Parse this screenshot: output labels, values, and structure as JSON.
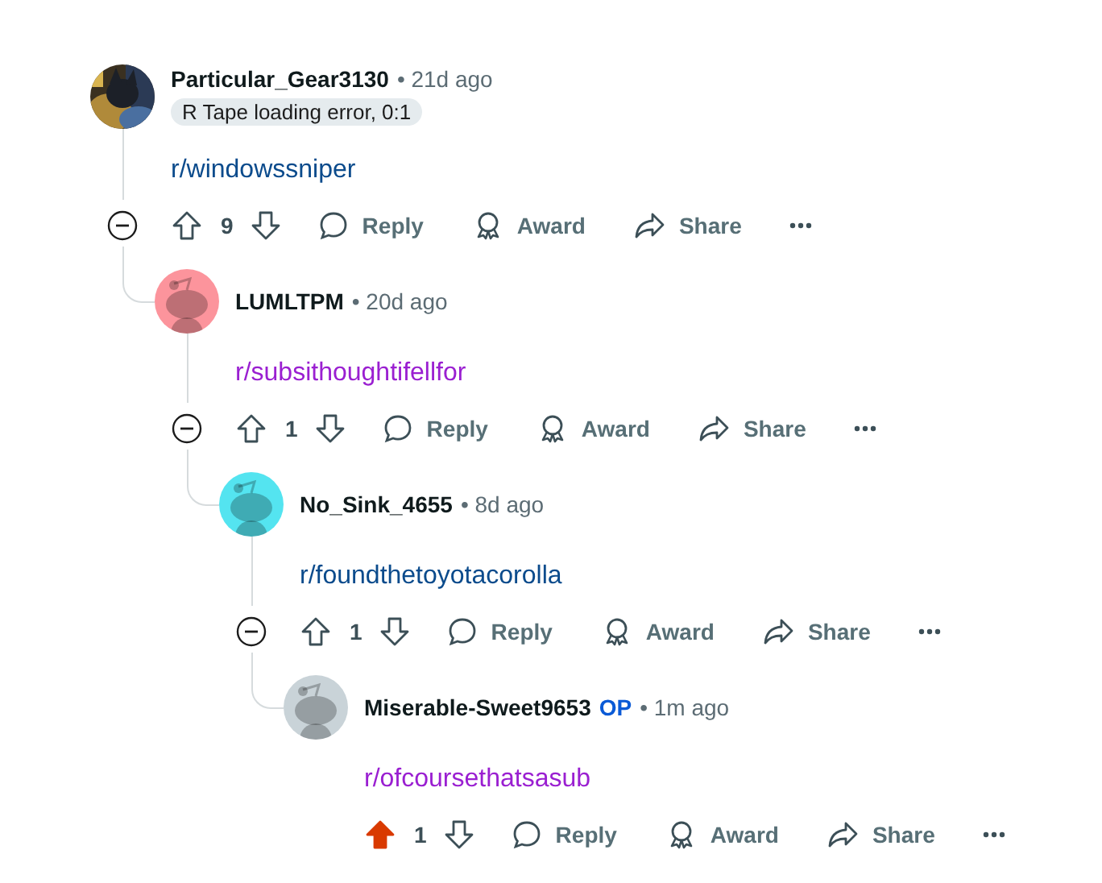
{
  "comments": [
    {
      "author": "Particular_Gear3130",
      "time": "• 21d ago",
      "flair": "R Tape loading error, 0:1",
      "body": "r/windowssniper",
      "visited": false,
      "score": "9",
      "upvoted": false,
      "actions": [
        "Reply",
        "Award",
        "Share"
      ],
      "children": [
        {
          "author": "LUMLTPM",
          "time": "• 20d ago",
          "avatar": {
            "kind": "snoo",
            "color": "#fc949c"
          },
          "body": "r/subsithoughtifellfor",
          "visited": true,
          "score": "1",
          "upvoted": false,
          "actions": [
            "Reply",
            "Award",
            "Share"
          ],
          "children": [
            {
              "author": "No_Sink_4655",
              "time": "• 8d ago",
              "avatar": {
                "kind": "snoo",
                "color": "#54e4f0"
              },
              "body": "r/foundthetoyotacorolla",
              "visited": false,
              "score": "1",
              "upvoted": false,
              "actions": [
                "Reply",
                "Award",
                "Share"
              ],
              "children": [
                {
                  "author": "Miserable-Sweet9653",
                  "op": "OP",
                  "time": "• 1m ago",
                  "avatar": {
                    "kind": "snoo",
                    "color": "#c9d3d8"
                  },
                  "body": "r/ofcoursethatsasub",
                  "visited": true,
                  "score": "1",
                  "upvoted": true,
                  "actions": [
                    "Reply",
                    "Award",
                    "Share"
                  ]
                }
              ]
            }
          ]
        }
      ]
    }
  ]
}
